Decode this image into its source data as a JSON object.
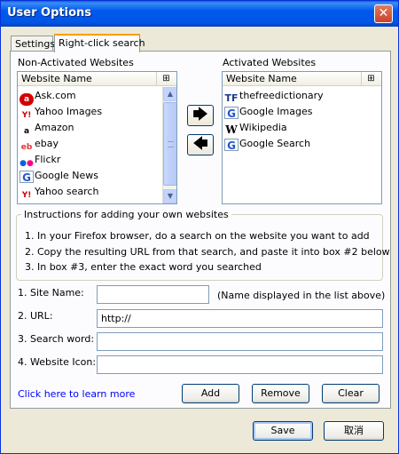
{
  "window": {
    "title": "User Options",
    "close_glyph": "✕"
  },
  "tabs": [
    {
      "label": "Settings",
      "active": false
    },
    {
      "label": "Right-click search",
      "active": true
    }
  ],
  "non_activated": {
    "label": "Non-Activated Websites",
    "column_header": "Website Name",
    "column_icon": "column-picker-icon",
    "items": [
      {
        "label": "Ask.com",
        "icon": "ask-icon"
      },
      {
        "label": "Yahoo Images",
        "icon": "yahoo-icon"
      },
      {
        "label": "Amazon",
        "icon": "amazon-icon"
      },
      {
        "label": "ebay",
        "icon": "ebay-icon"
      },
      {
        "label": "Flickr",
        "icon": "flickr-icon"
      },
      {
        "label": "Google News",
        "icon": "google-icon"
      },
      {
        "label": "Yahoo search",
        "icon": "yahoo-icon"
      }
    ]
  },
  "activated": {
    "label": "Activated Websites",
    "column_header": "Website Name",
    "column_icon": "column-picker-icon",
    "items": [
      {
        "label": "thefreedictionary",
        "icon": "thefreedictionary-icon"
      },
      {
        "label": "Google Images",
        "icon": "google-icon"
      },
      {
        "label": "Wikipedia",
        "icon": "wikipedia-icon"
      },
      {
        "label": "Google Search",
        "icon": "google-icon"
      }
    ]
  },
  "move_buttons": {
    "right_glyph": "🡆",
    "left_glyph": "🡄"
  },
  "instructions": {
    "title": "Instructions for adding your own websites",
    "steps": [
      "1. In your Firefox browser, do a search on the website you want to add",
      "2. Copy the resulting URL from that search, and paste it into box #2 below",
      "3. In box #3, enter the exact word you searched"
    ]
  },
  "form": {
    "site_name_label": "1. Site Name:",
    "site_name_value": "",
    "site_name_note": "(Name displayed in the list above)",
    "url_label": "2. URL:",
    "url_value": "http://",
    "search_word_label": "3. Search word:",
    "search_word_value": "",
    "website_icon_label": "4. Website Icon:",
    "website_icon_value": ""
  },
  "learn_more": "Click here to learn more",
  "buttons": {
    "add": "Add",
    "remove": "Remove",
    "clear": "Clear",
    "save": "Save",
    "cancel": "取消"
  },
  "colors": {
    "title_bar": "#0055e5",
    "dialog_bg": "#ece9d8",
    "link": "#0000ff",
    "tab_highlight": "#ff9c00"
  }
}
